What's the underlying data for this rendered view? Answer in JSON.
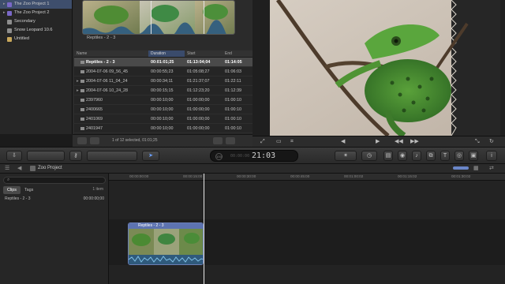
{
  "library": {
    "items": [
      {
        "label": "The Zoo Project 1",
        "icon": "event-star-icon",
        "selected": true
      },
      {
        "label": "The Zoo Project 2",
        "icon": "event-star-icon",
        "selected": false
      },
      {
        "label": "Secondary",
        "icon": "disk-icon",
        "selected": false
      },
      {
        "label": "Snow Leopard 10.6",
        "icon": "disk-icon",
        "selected": false
      },
      {
        "label": "Untitled",
        "icon": "folder-icon",
        "selected": false
      }
    ]
  },
  "browser": {
    "filmstrip_label": "Reptiles - 2 - 3",
    "columns": {
      "name": "Name",
      "duration": "Duration",
      "start": "Start",
      "end": "End"
    },
    "rows": [
      {
        "name": "Reptiles - 2 - 3",
        "duration": "00:01:01;25",
        "start": "01:13:04;04",
        "end": "01:14:05",
        "selected": true,
        "disclosure": false
      },
      {
        "name": "2004-07-06 09_56_45",
        "duration": "00:00:55;23",
        "start": "01:05:08;27",
        "end": "01:06:03",
        "selected": false,
        "disclosure": false
      },
      {
        "name": "2004-07-06 11_04_24",
        "duration": "00:00:34;11",
        "start": "01:21:37;07",
        "end": "01:22:11",
        "selected": false,
        "disclosure": true
      },
      {
        "name": "2004-07-06 10_24_28",
        "duration": "00:00:15;15",
        "start": "01:12:23;20",
        "end": "01:12:39",
        "selected": false,
        "disclosure": true
      },
      {
        "name": "2397960",
        "duration": "00:00:10;00",
        "start": "01:00:00;00",
        "end": "01:00:10",
        "selected": false,
        "disclosure": false
      },
      {
        "name": "2400665",
        "duration": "00:00:10;00",
        "start": "01:00:00;00",
        "end": "01:00:10",
        "selected": false,
        "disclosure": false
      },
      {
        "name": "2401069",
        "duration": "00:00:10;00",
        "start": "01:00:00;00",
        "end": "01:00:10",
        "selected": false,
        "disclosure": false
      },
      {
        "name": "2401947",
        "duration": "00:00:10;00",
        "start": "01:00:00;00",
        "end": "01:00:10",
        "selected": false,
        "disclosure": false
      }
    ],
    "status": "1 of 12 selected, 01:01;25"
  },
  "toolbar": {
    "timecode": "21:03",
    "timecode_faint": "00:00:00",
    "timecode_hundreds": "100"
  },
  "timeline": {
    "project_title": "Zoo Project",
    "search_placeholder": "",
    "tabs": [
      "Clips",
      "Tags"
    ],
    "active_tab": "Clips",
    "count": "1 item",
    "index_row": {
      "name": "Reptiles - 2 - 3",
      "tc": "00:00:00;00"
    },
    "ruler_ticks": [
      "00:00:00:00",
      "00:00:15:00",
      "00:00:30:00",
      "00:00:45:00",
      "00:01:00:02",
      "00:01:15:02",
      "00:01:30:02"
    ],
    "clip_title": "Reptiles - 2 - 3"
  },
  "colors": {
    "selection_blue": "#3e4e6c",
    "clip_header": "#5d73b0",
    "playhead": "#e9e9e9",
    "accent_timecode": "#d0d0d0"
  }
}
